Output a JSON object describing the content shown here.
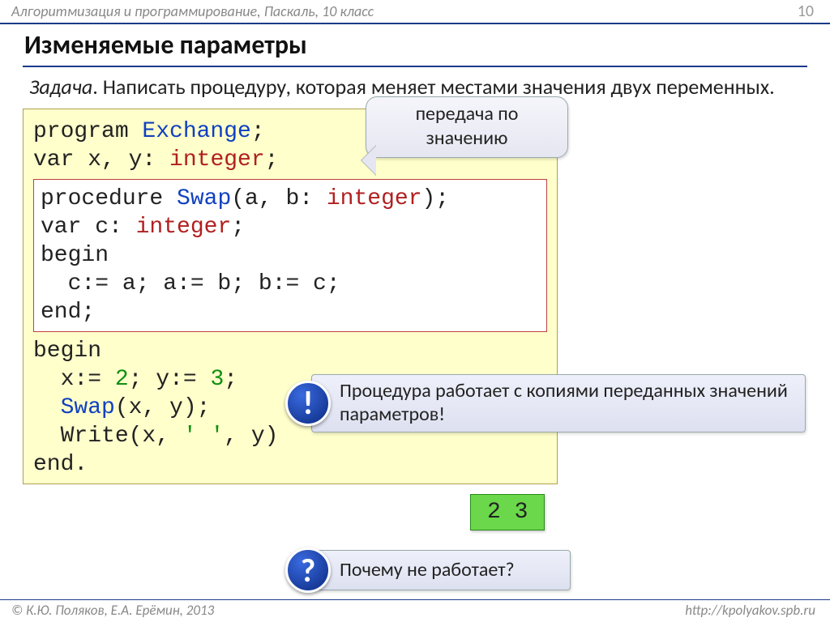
{
  "header": {
    "breadcrumb": "Алгоритмизация и программирование, Паскаль, 10 класс",
    "page_number": "10"
  },
  "title": "Изменяемые параметры",
  "task": {
    "label": "Задача",
    "text": ". Написать процедуру, которая меняет местами значения двух переменных."
  },
  "code": {
    "line1_a": "program ",
    "line1_b": "Exchange",
    "line1_c": ";",
    "line2_a": "var x, y: ",
    "line2_b": "integer",
    "line2_c": ";",
    "inner1_a": "procedure ",
    "inner1_b": "Swap",
    "inner1_c": "(a, b: ",
    "inner1_d": "integer",
    "inner1_e": ");",
    "inner2_a": "var c: ",
    "inner2_b": "integer",
    "inner2_c": ";",
    "inner3": "begin",
    "inner4": "  c:= a; a:= b; b:= c;",
    "inner5": "end;",
    "line3": "begin",
    "line4_a": "  x:= ",
    "line4_b": "2",
    "line4_c": "; y:= ",
    "line4_d": "3",
    "line4_e": ";",
    "line5_a": "  ",
    "line5_b": "Swap",
    "line5_c": "(x, y);",
    "line6_a": "  Write(x, ",
    "line6_b": "' '",
    "line6_c": ", y)",
    "line7": "end."
  },
  "callout": "передача по значению",
  "note1": "Процедура работает с копиями переданных значений параметров!",
  "note2": "Почему не работает?",
  "result": "2 3",
  "footer": {
    "left": "© К.Ю. Поляков, Е.А. Ерёмин, 2013",
    "right": "http://kpolyakov.spb.ru"
  }
}
